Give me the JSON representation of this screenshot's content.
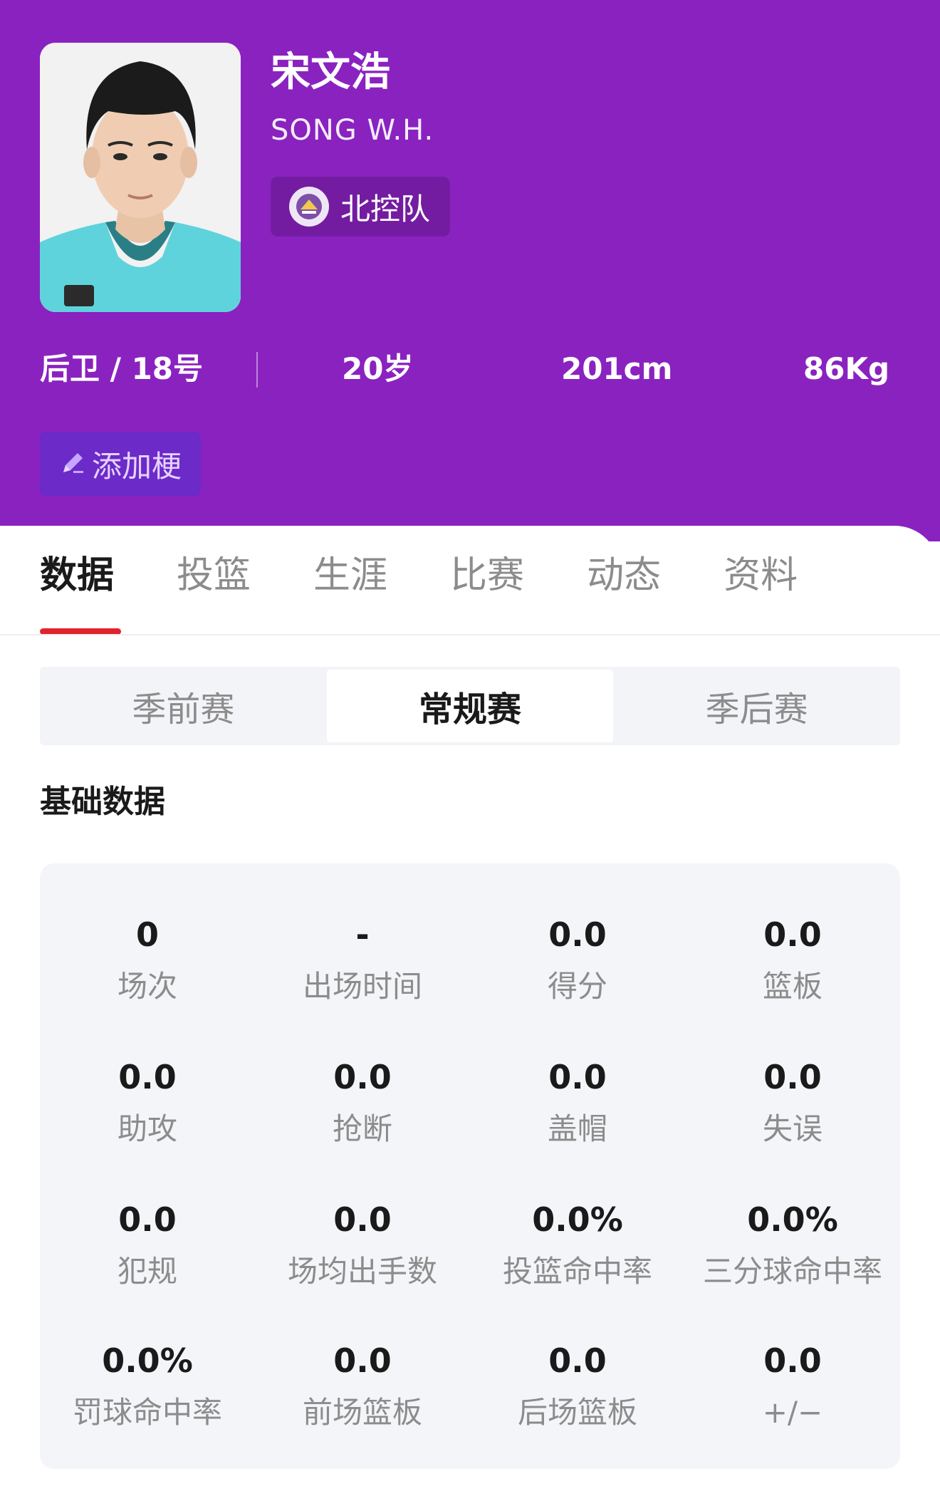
{
  "player": {
    "name_cn": "宋文浩",
    "name_en": "SONG W.H.",
    "team": "北控队",
    "position_number": "后卫 / 18号",
    "age": "20岁",
    "height": "201cm",
    "weight": "86Kg",
    "meme_button": "添加梗"
  },
  "colors": {
    "header_bg": "#8a22c0",
    "accent_red": "#e2232d",
    "jersey": "#5fd3dc"
  },
  "tabs": [
    {
      "label": "数据",
      "active": true
    },
    {
      "label": "投篮",
      "active": false
    },
    {
      "label": "生涯",
      "active": false
    },
    {
      "label": "比赛",
      "active": false
    },
    {
      "label": "动态",
      "active": false
    },
    {
      "label": "资料",
      "active": false
    }
  ],
  "season_types": [
    {
      "label": "季前赛",
      "active": false
    },
    {
      "label": "常规赛",
      "active": true
    },
    {
      "label": "季后赛",
      "active": false
    }
  ],
  "section_title": "基础数据",
  "stats": [
    {
      "value": "0",
      "label": "场次"
    },
    {
      "value": "-",
      "label": "出场时间"
    },
    {
      "value": "0.0",
      "label": "得分"
    },
    {
      "value": "0.0",
      "label": "篮板"
    },
    {
      "value": "0.0",
      "label": "助攻"
    },
    {
      "value": "0.0",
      "label": "抢断"
    },
    {
      "value": "0.0",
      "label": "盖帽"
    },
    {
      "value": "0.0",
      "label": "失误"
    },
    {
      "value": "0.0",
      "label": "犯规"
    },
    {
      "value": "0.0",
      "label": "场均出手数"
    },
    {
      "value": "0.0%",
      "label": "投篮命中率"
    },
    {
      "value": "0.0%",
      "label": "三分球命中率"
    },
    {
      "value": "0.0%",
      "label": "罚球命中率"
    },
    {
      "value": "0.0",
      "label": "前场篮板"
    },
    {
      "value": "0.0",
      "label": "后场篮板"
    },
    {
      "value": "0.0",
      "label": "+/−"
    }
  ]
}
